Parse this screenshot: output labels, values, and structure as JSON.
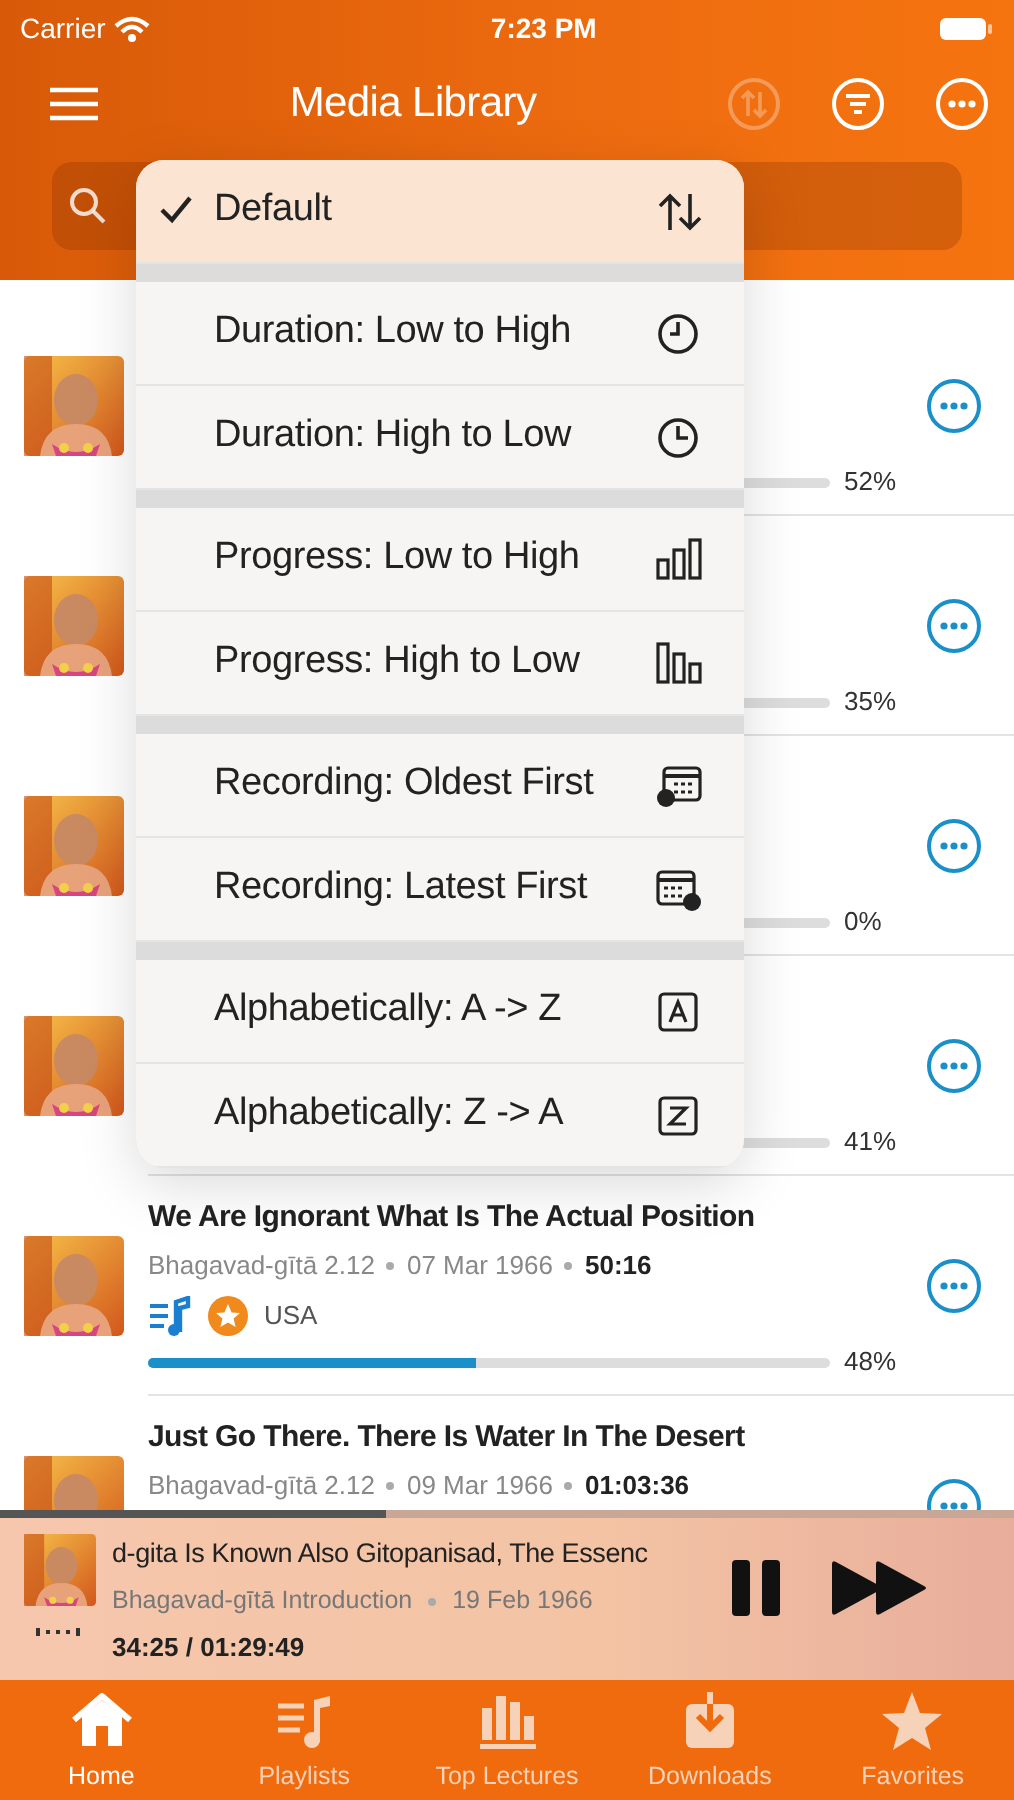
{
  "status_bar": {
    "carrier": "Carrier",
    "time": "7:23 PM"
  },
  "nav": {
    "title": "Media Library",
    "sort_disabled": true
  },
  "search": {
    "icon": true
  },
  "sort_menu": {
    "groups": [
      {
        "items": [
          {
            "label": "Default",
            "selected": true
          }
        ]
      },
      {
        "items": [
          {
            "label": "Duration: Low to High",
            "selected": false
          },
          {
            "label": "Duration: High to Low",
            "selected": false
          }
        ]
      },
      {
        "items": [
          {
            "label": "Progress: Low to High",
            "selected": false
          },
          {
            "label": "Progress: High to Low",
            "selected": false
          }
        ]
      },
      {
        "items": [
          {
            "label": "Recording: Oldest First",
            "selected": false
          },
          {
            "label": "Recording: Latest First",
            "selected": false
          }
        ]
      },
      {
        "items": [
          {
            "label": "Alphabetically: A -> Z",
            "selected": false
          },
          {
            "label": "Alphabetically: Z -> A",
            "selected": false
          }
        ]
      }
    ]
  },
  "lectures": [
    {
      "percent": "52%"
    },
    {
      "percent": "35%"
    },
    {
      "percent": "0%"
    },
    {
      "percent": "41%"
    },
    {
      "title": "We Are Ignorant What Is The Actual Position",
      "source": "Bhagavad-gītā 2.12",
      "date": "07 Mar 1966",
      "duration": "50:16",
      "in_playlist": true,
      "favorite": true,
      "place": "USA",
      "level": 0.48,
      "percent": "48%"
    },
    {
      "title": "Just Go There. There Is Water In The Desert",
      "source": "Bhagavad-gītā 2.12",
      "date": "09 Mar 1966",
      "duration": "01:03:36"
    }
  ],
  "player": {
    "level": 0.38,
    "title": "d-gita Is Known Also Gitopanisad, The Essenc",
    "source": "Bhagavad-gītā Introduction",
    "date": "19 Feb 1966",
    "time": "34:25 / 01:29:49",
    "playing": true
  },
  "tabs": [
    {
      "label": "Home",
      "selected": true
    },
    {
      "label": "Playlists",
      "selected": false
    },
    {
      "label": "Top Lectures",
      "selected": false
    },
    {
      "label": "Downloads",
      "selected": false
    },
    {
      "label": "Favorites",
      "selected": false
    }
  ]
}
